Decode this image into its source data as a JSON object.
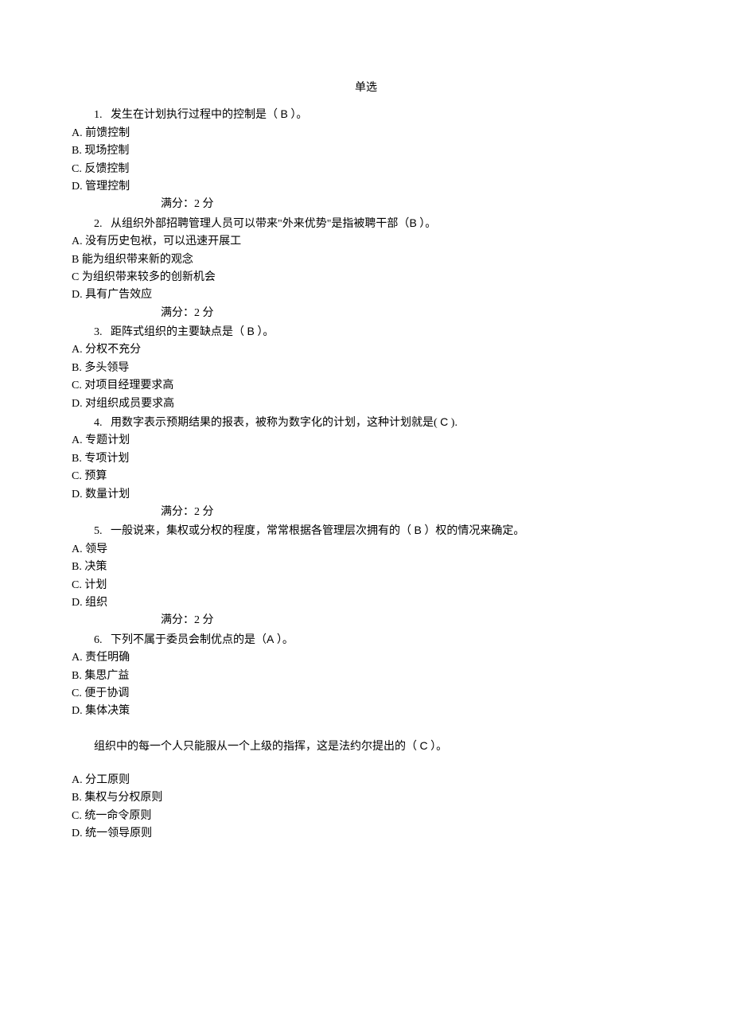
{
  "title": "单选",
  "score_template": "满分：2    分",
  "questions": [
    {
      "num": "1.",
      "stem_pre": "发生在计划执行过程中的控制是（  ",
      "answer": "B",
      "stem_post": "  ）。",
      "options": [
        "A. 前馈控制",
        "B. 现场控制",
        "C. 反馈控制",
        "D. 管理控制"
      ],
      "show_score": true
    },
    {
      "num": "2.",
      "stem_pre": "从组织外部招聘管理人员可以带来\"外来优势\"是指被聘干部（",
      "answer": "B",
      "stem_post": "  ）。",
      "options": [
        "A. 没有历史包袱，可以迅速开展工",
        "B 能为组织带来新的观念",
        "C 为组织带来较多的创新机会",
        "D. 具有广告效应"
      ],
      "show_score": true
    },
    {
      "num": "3.",
      "stem_pre": "距阵式组织的主要缺点是（ ",
      "answer": "B",
      "stem_post": "  ）。",
      "options": [
        "A. 分权不充分",
        "B. 多头领导",
        "C. 对项目经理要求高",
        "D. 对组织成员要求高"
      ],
      "show_score": false
    },
    {
      "num": "4.",
      "stem_pre": "用数字表示预期结果的报表，被称为数字化的计划，这种计划就是( ",
      "answer": "C",
      "stem_post": "  ).",
      "options": [
        "A. 专题计划",
        "B. 专项计划",
        "C. 预算",
        "D. 数量计划"
      ],
      "show_score": true
    },
    {
      "num": "5.",
      "stem_pre": "一般说来，集权或分权的程度，常常根据各管理层次拥有的（   ",
      "answer": "B",
      "stem_post": "    ）权的情况来确定。",
      "options": [
        "A. 领导",
        "B. 决策",
        "C. 计划",
        "D. 组织"
      ],
      "show_score": true
    },
    {
      "num": "6.",
      "stem_pre": "下列不属于委员会制优点的是（",
      "answer": "A",
      "stem_post": "   ）。",
      "options": [
        "A. 责任明确",
        "B. 集思广益",
        "C. 便于协调",
        "D. 集体决策"
      ],
      "show_score": false
    }
  ],
  "question7": {
    "stem_pre": "组织中的每一个人只能服从一个上级的指挥，这是法约尔提出的（ ",
    "answer": "C",
    "stem_post": "  ）。",
    "options": [
      "A. 分工原则",
      "B. 集权与分权原则",
      "C. 统一命令原则",
      "D. 统一领导原则"
    ]
  }
}
